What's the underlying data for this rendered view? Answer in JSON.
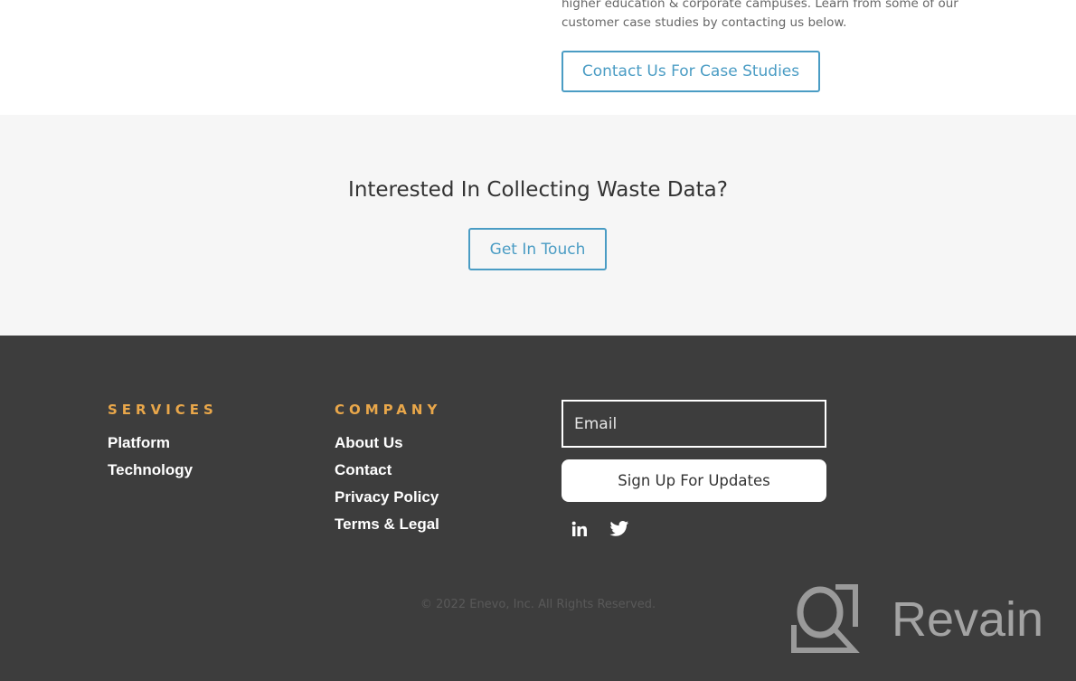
{
  "intro": {
    "line1": "higher education & corporate campuses. Learn from some of our",
    "line2": "customer case studies by contacting us below.",
    "button_label": "Contact Us For Case Studies"
  },
  "cta": {
    "title": "Interested In Collecting Waste Data?",
    "button_label": "Get In Touch"
  },
  "footer": {
    "services": {
      "heading": "SERVICES",
      "links": [
        "Platform",
        "Technology"
      ]
    },
    "company": {
      "heading": "COMPANY",
      "links": [
        "About Us",
        "Contact",
        "Privacy Policy",
        "Terms & Legal"
      ]
    },
    "newsletter": {
      "email_placeholder": "Email",
      "email_value": "",
      "button_label": "Sign Up For Updates"
    },
    "social": [
      {
        "icon": "linkedin-icon",
        "glyph": "in"
      },
      {
        "icon": "twitter-icon",
        "glyph": ""
      }
    ],
    "copyright": "© 2022 Enevo, Inc. All Rights Reserved."
  },
  "watermark": {
    "text": "Revain"
  },
  "colors": {
    "accent": "#4a9cc4",
    "heading_accent": "#e9a74a",
    "footer_bg": "#3d3d3d",
    "cta_bg": "#f6f6f6"
  }
}
